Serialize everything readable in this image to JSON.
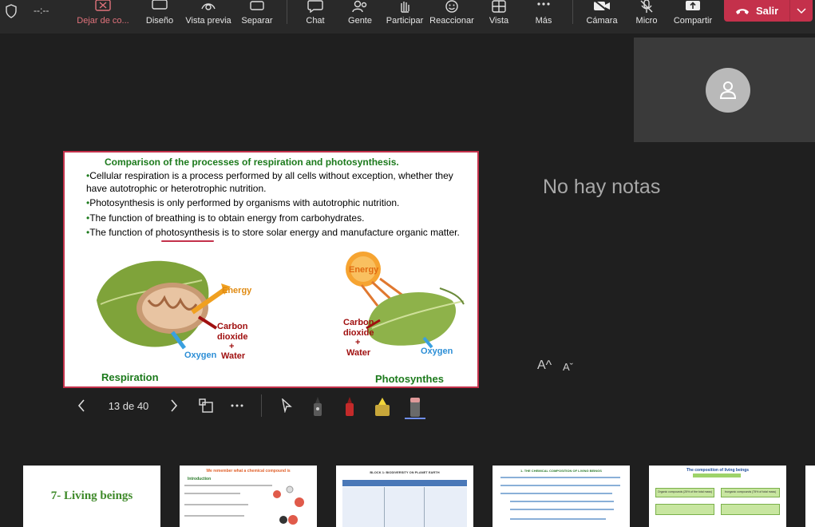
{
  "toolbar": {
    "timer": "--:--",
    "items": [
      {
        "label": "Dejar de co...",
        "icon": "stop-presenting-icon"
      },
      {
        "label": "Diseño",
        "icon": "layout-icon"
      },
      {
        "label": "Vista previa",
        "icon": "preview-icon"
      },
      {
        "label": "Separar",
        "icon": "pop-out-icon"
      },
      {
        "label": "Chat",
        "icon": "chat-icon"
      },
      {
        "label": "Gente",
        "icon": "people-icon"
      },
      {
        "label": "Participar",
        "icon": "raise-hand-icon"
      },
      {
        "label": "Reaccionar",
        "icon": "react-icon"
      },
      {
        "label": "Vista",
        "icon": "view-icon"
      },
      {
        "label": "Más",
        "icon": "more-icon"
      },
      {
        "label": "Cámara",
        "icon": "camera-off-icon"
      },
      {
        "label": "Micro",
        "icon": "mic-off-icon"
      },
      {
        "label": "Compartir",
        "icon": "share-icon"
      }
    ],
    "leave_label": "Salir",
    "accent_red": "#c4314b"
  },
  "notes": {
    "empty_text": "No hay notas",
    "font_increase": "A^",
    "font_decrease": "Aˇ"
  },
  "slide": {
    "title": "Comparison of the processes of respiration and photosynthesis.",
    "bullets": [
      "Cellular respiration is a process performed by all cells without exception, whether they have autotrophic or heterotrophic nutrition.",
      "Photosynthesis is only performed by organisms with autotrophic nutrition.",
      "The function of breathing is to obtain energy from carbohydrates.",
      "The function of photosynthesis is to store solar energy and manufacture organic matter."
    ],
    "left_diagram": {
      "energy": "Energy",
      "carbon1": "Carbon",
      "carbon2": "dioxide",
      "plus": "+",
      "water": "Water",
      "oxygen": "Oxygen"
    },
    "right_diagram": {
      "energy": "Energy",
      "carbon1": "Carbon",
      "carbon2": "dioxide",
      "plus": "+",
      "water": "Water",
      "oxygen": "Oxygen"
    },
    "caption_left": "Respiration",
    "caption_right": "Photosynthes"
  },
  "controls": {
    "counter": "13 de 40",
    "tools": [
      "prev-icon",
      "next-icon",
      "grid-view-icon",
      "more-options-icon",
      "laser-pointer-icon",
      "pen-black-icon",
      "pen-red-icon",
      "highlighter-icon",
      "eraser-icon"
    ]
  },
  "thumbnails": [
    {
      "title": "7- Living beings"
    },
    {
      "title": "We remember what a chemical compound is",
      "sub": "Introduction"
    },
    {
      "title": "BLOCK 1: BIODIVERSITY ON PLANET EARTH"
    },
    {
      "title": "1- THE CHEMICAL COMPOSITION OF LIVING BEINGS"
    },
    {
      "title": "The composition of living beings",
      "cells": [
        "Organic compounds (25% of the total mass)",
        "Inorganic compounds (75% of total mass)"
      ]
    }
  ]
}
